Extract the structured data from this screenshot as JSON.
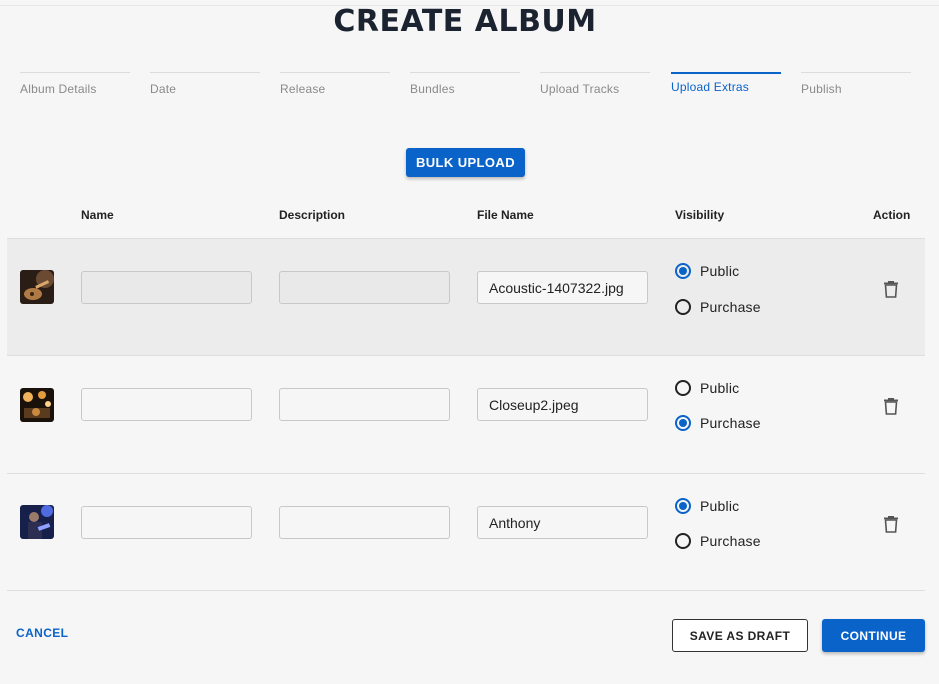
{
  "page": {
    "title": "CREATE ALBUM"
  },
  "stepper": {
    "steps": [
      {
        "label": "Album Details",
        "active": false
      },
      {
        "label": "Date",
        "active": false
      },
      {
        "label": "Release",
        "active": false
      },
      {
        "label": "Bundles",
        "active": false
      },
      {
        "label": "Upload Tracks",
        "active": false
      },
      {
        "label": "Upload Extras",
        "active": true
      },
      {
        "label": "Publish",
        "active": false
      }
    ]
  },
  "toolbar": {
    "bulk_upload_label": "BULK UPLOAD"
  },
  "table": {
    "headers": {
      "name": "Name",
      "description": "Description",
      "file_name": "File Name",
      "visibility": "Visibility",
      "action": "Action"
    },
    "visibility_options": {
      "public": "Public",
      "purchase": "Purchase"
    },
    "rows": [
      {
        "thumbnail": "acoustic-guitar-photo",
        "name": "",
        "description": "",
        "file_name": "Acoustic-1407322.jpg",
        "visibility": "public",
        "action_icon": "trash-icon"
      },
      {
        "thumbnail": "stage-lights-photo",
        "name": "",
        "description": "",
        "file_name": "Closeup2.jpeg",
        "visibility": "purchase",
        "action_icon": "trash-icon"
      },
      {
        "thumbnail": "performer-photo",
        "name": "",
        "description": "",
        "file_name": "Anthony",
        "visibility": "public",
        "action_icon": "trash-icon"
      }
    ]
  },
  "footer": {
    "cancel_label": "CANCEL",
    "save_draft_label": "SAVE AS DRAFT",
    "continue_label": "CONTINUE"
  },
  "colors": {
    "accent": "#0a63c9",
    "title": "#1b2230",
    "background": "#f6f6f6",
    "row_highlight": "#ececec"
  }
}
